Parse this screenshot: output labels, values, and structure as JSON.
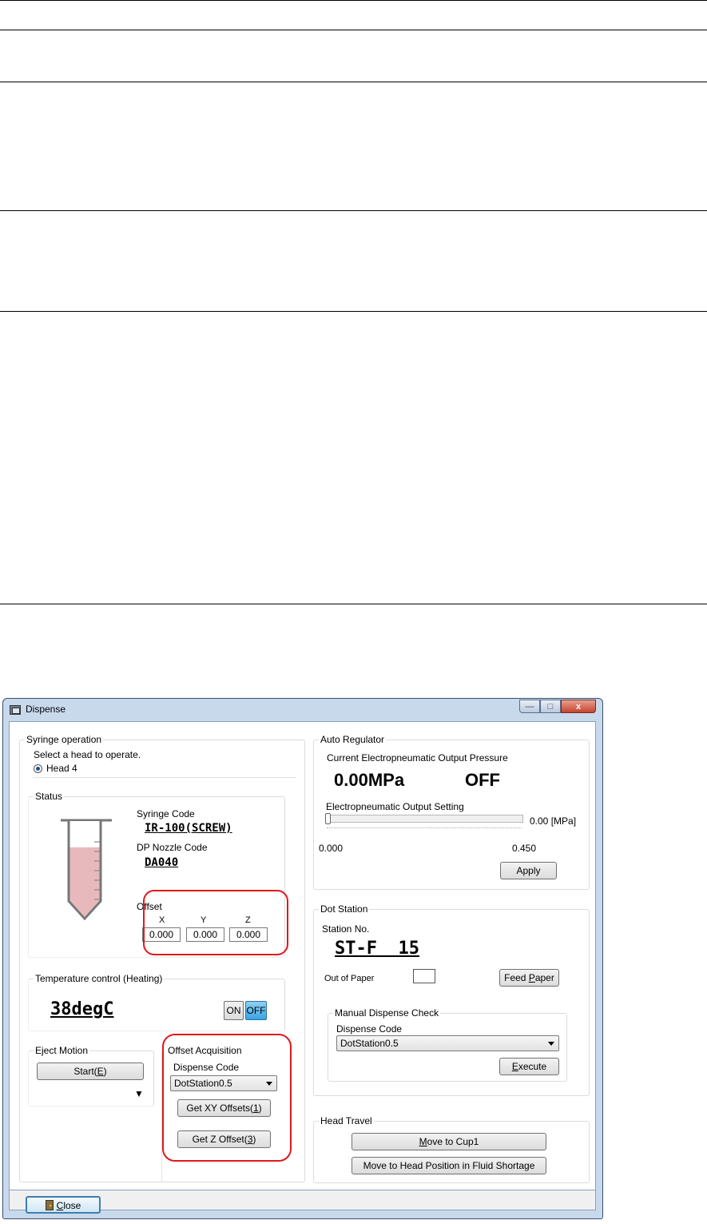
{
  "window": {
    "title": "Dispense",
    "minimize": "—",
    "maximize": "□",
    "close": "x"
  },
  "syringe": {
    "group": "Syringe operation",
    "select_label": "Select a head to operate.",
    "head": "Head 4",
    "status_group": "Status",
    "syringe_code_label": "Syringe Code",
    "syringe_code": "IR-100(SCREW)",
    "nozzle_label": "DP Nozzle Code",
    "nozzle_code": "DA040",
    "offset_label": "Offset",
    "x_label": "X",
    "y_label": "Y",
    "z_label": "Z",
    "x": "0.000",
    "y": "0.000",
    "z": "0.000",
    "fill_level": 0.78
  },
  "temperature": {
    "group": "Temperature control (Heating)",
    "value": "38degC",
    "on": "ON",
    "off": "OFF"
  },
  "eject": {
    "group": "Eject Motion",
    "start": "Start(",
    "start_key": "E",
    "start_end": ")",
    "arrow": "▼"
  },
  "offset_acq": {
    "group": "Offset Acquisition",
    "code_label": "Dispense Code",
    "code": "DotStation0.5",
    "xy_btn": "Get XY Offsets(",
    "xy_key": "1",
    "xy_end": ")",
    "z_btn": "Get Z Offset(",
    "z_key": "3",
    "z_end": ")"
  },
  "auto_regulator": {
    "group": "Auto Regulator",
    "pressure_label": "Current Electropneumatic Output Pressure",
    "pressure": "0.00MPa",
    "state": "OFF",
    "setting_label": "Electropneumatic Output Setting",
    "setting_value": "0.00 [MPa]",
    "min": "0.000",
    "max": "0.450",
    "apply": "Apply",
    "slider_fraction": 0.0
  },
  "dot_station": {
    "group": "Dot Station",
    "station_label": "Station No.",
    "station": "ST-F  15",
    "paper_label": "Out of Paper",
    "feed_btn": "Feed ",
    "feed_key": "P",
    "feed_end": "aper",
    "manual_group": "Manual Dispense Check",
    "code_label": "Dispense Code",
    "code": "DotStation0.5",
    "execute_key": "E",
    "execute_end": "xecute"
  },
  "head_travel": {
    "group": "Head Travel",
    "cup_key": "M",
    "cup_end": "ove to Cup1",
    "shortage_btn": "Move to Head Position in Fluid Shortage"
  },
  "footer": {
    "close_key": "C",
    "close_end": "lose"
  }
}
